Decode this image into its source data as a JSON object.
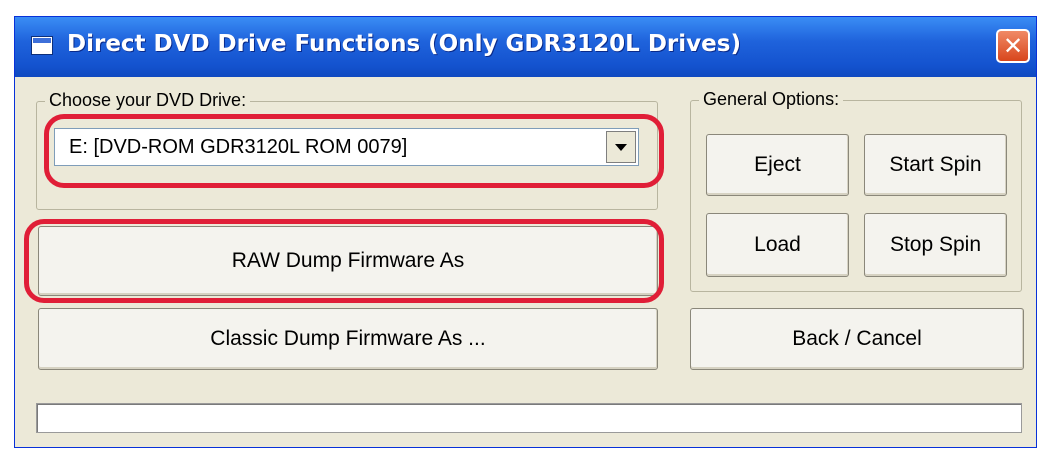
{
  "window": {
    "title": "Direct DVD Drive Functions (Only GDR3120L Drives)",
    "close_glyph": "✕"
  },
  "drive_group": {
    "legend": "Choose your DVD Drive:",
    "selected_drive": "E: [DVD-ROM GDR3120L ROM 0079]"
  },
  "general_group": {
    "legend": "General Options:",
    "eject_label": "Eject",
    "start_spin_label": "Start Spin",
    "load_label": "Load",
    "stop_spin_label": "Stop Spin"
  },
  "actions": {
    "raw_dump_label": "RAW Dump Firmware As",
    "classic_dump_label": "Classic Dump Firmware As ...",
    "back_cancel_label": "Back / Cancel"
  },
  "progress": {
    "value": 0
  },
  "colors": {
    "highlight": "#e01e37",
    "titlebar": "#1f63dc",
    "window_bg": "#ece9d8"
  },
  "icons": {
    "title_icon": "app-window-icon",
    "close_icon": "close-icon",
    "dropdown_icon": "chevron-down-icon"
  }
}
